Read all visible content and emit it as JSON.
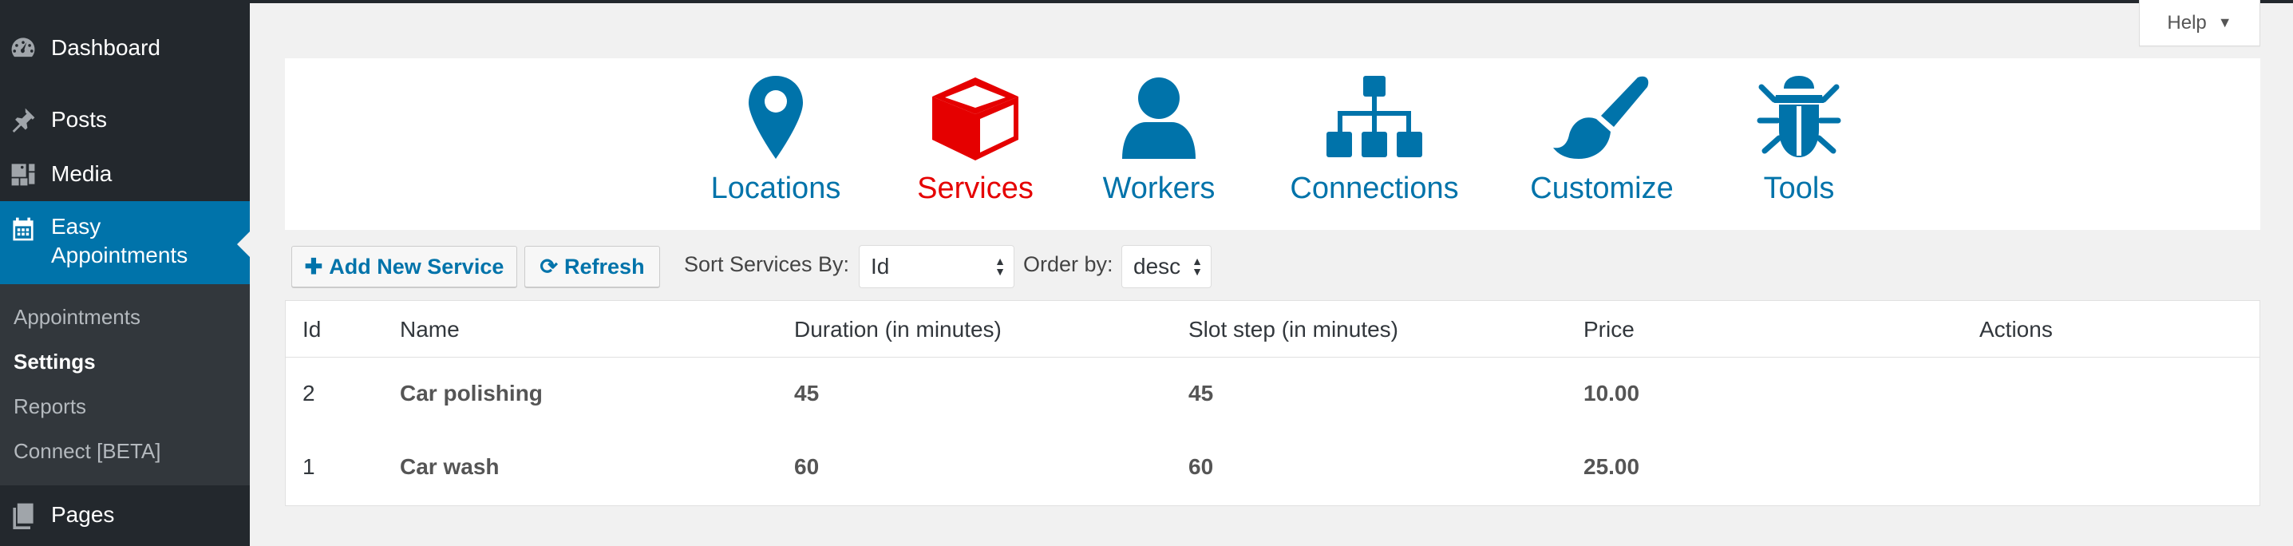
{
  "sidebar": {
    "items": [
      {
        "label": "Dashboard",
        "icon": "dashboard-icon"
      },
      {
        "label": "Posts",
        "icon": "pin-icon"
      },
      {
        "label": "Media",
        "icon": "media-icon"
      },
      {
        "label": "Easy Appointments",
        "label_line1": "Easy",
        "label_line2": "Appointments",
        "icon": "calendar-icon",
        "active": true
      },
      {
        "label": "Pages",
        "icon": "pages-icon"
      }
    ],
    "submenu": [
      "Appointments",
      "Settings",
      "Reports",
      "Connect [BETA]"
    ],
    "submenu_current": "Settings"
  },
  "help": {
    "label": "Help",
    "caret": "▼"
  },
  "nav": {
    "items": [
      {
        "label": "Locations",
        "icon": "map-marker-icon"
      },
      {
        "label": "Services",
        "icon": "cube-icon",
        "active": true
      },
      {
        "label": "Workers",
        "icon": "user-icon"
      },
      {
        "label": "Connections",
        "icon": "sitemap-icon"
      },
      {
        "label": "Customize",
        "icon": "paint-brush-icon"
      },
      {
        "label": "Tools",
        "icon": "bug-icon"
      }
    ],
    "accent": "#0073aa",
    "active_color": "#e50000"
  },
  "toolbar": {
    "add_label": "Add New Service",
    "refresh_label": "Refresh",
    "sort_label": "Sort Services By:",
    "sort_value": "Id",
    "order_label": "Order by:",
    "order_value": "desc"
  },
  "table": {
    "headers": [
      "Id",
      "Name",
      "Duration (in minutes)",
      "Slot step (in minutes)",
      "Price",
      "Actions"
    ],
    "rows": [
      [
        "2",
        "Car polishing",
        "45",
        "45",
        "10.00"
      ],
      [
        "1",
        "Car wash",
        "60",
        "60",
        "25.00"
      ]
    ]
  }
}
